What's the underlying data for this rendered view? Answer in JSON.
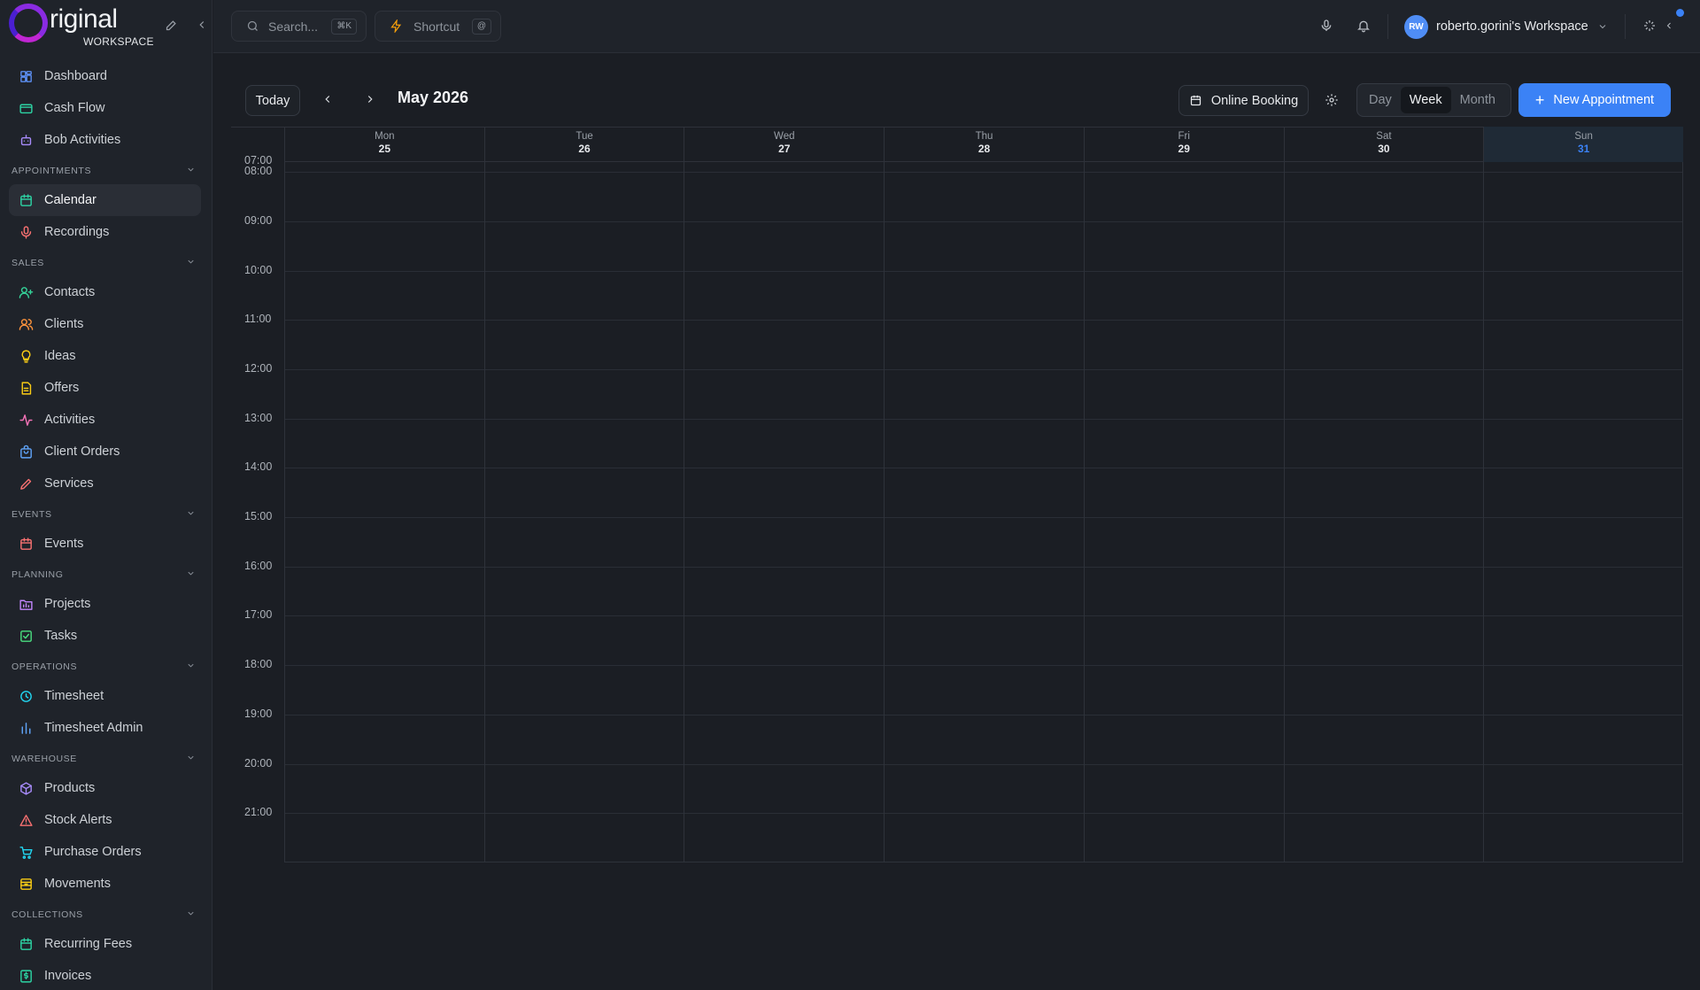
{
  "brand": {
    "logo_text": "riginal",
    "logo_sub": "WORKSPACE"
  },
  "sidebar": {
    "groups": [
      {
        "section": null,
        "items": [
          {
            "label": "Dashboard",
            "icon": "grid-icon",
            "color": "#5b8def"
          },
          {
            "label": "Cash Flow",
            "icon": "wallet-icon",
            "color": "#2dd4a4"
          },
          {
            "label": "Bob Activities",
            "icon": "bot-icon",
            "color": "#a78bfa"
          }
        ]
      },
      {
        "section": "APPOINTMENTS",
        "items": [
          {
            "label": "Calendar",
            "icon": "calendar-icon",
            "color": "#2dd4a4",
            "active": true
          },
          {
            "label": "Recordings",
            "icon": "mic-icon",
            "color": "#f87171"
          }
        ]
      },
      {
        "section": "SALES",
        "items": [
          {
            "label": "Contacts",
            "icon": "user-plus-icon",
            "color": "#34d399"
          },
          {
            "label": "Clients",
            "icon": "users-icon",
            "color": "#fb923c"
          },
          {
            "label": "Ideas",
            "icon": "lightbulb-icon",
            "color": "#facc15"
          },
          {
            "label": "Offers",
            "icon": "document-icon",
            "color": "#facc15"
          },
          {
            "label": "Activities",
            "icon": "activity-icon",
            "color": "#f472b6"
          },
          {
            "label": "Client Orders",
            "icon": "bag-icon",
            "color": "#60a5fa"
          },
          {
            "label": "Services",
            "icon": "pen-icon",
            "color": "#f87171"
          }
        ]
      },
      {
        "section": "EVENTS",
        "items": [
          {
            "label": "Events",
            "icon": "calendar-icon",
            "color": "#f87171"
          }
        ]
      },
      {
        "section": "PLANNING",
        "items": [
          {
            "label": "Projects",
            "icon": "folder-chart-icon",
            "color": "#c084fc"
          },
          {
            "label": "Tasks",
            "icon": "check-square-icon",
            "color": "#4ade80"
          }
        ]
      },
      {
        "section": "OPERATIONS",
        "items": [
          {
            "label": "Timesheet",
            "icon": "clock-icon",
            "color": "#22d3ee"
          },
          {
            "label": "Timesheet Admin",
            "icon": "bar-chart-icon",
            "color": "#60a5fa"
          }
        ]
      },
      {
        "section": "WAREHOUSE",
        "items": [
          {
            "label": "Products",
            "icon": "box-icon",
            "color": "#a78bfa"
          },
          {
            "label": "Stock Alerts",
            "icon": "alert-triangle-icon",
            "color": "#f87171"
          },
          {
            "label": "Purchase Orders",
            "icon": "cart-icon",
            "color": "#22d3ee"
          },
          {
            "label": "Movements",
            "icon": "archive-icon",
            "color": "#facc15"
          }
        ]
      },
      {
        "section": "COLLECTIONS",
        "items": [
          {
            "label": "Recurring Fees",
            "icon": "calendar-icon",
            "color": "#2dd4a4"
          },
          {
            "label": "Invoices",
            "icon": "dollar-file-icon",
            "color": "#2dd4a4"
          }
        ]
      }
    ]
  },
  "topbar": {
    "search_placeholder": "Search...",
    "search_kbd": "⌘K",
    "shortcut_label": "Shortcut",
    "shortcut_kbd": "@",
    "workspace_initials": "RW",
    "workspace_name": "roberto.gorini's Workspace"
  },
  "toolbar": {
    "today": "Today",
    "month_title": "May 2026",
    "online_booking": "Online Booking",
    "views": [
      "Day",
      "Week",
      "Month"
    ],
    "active_view": "Week",
    "new_appointment": "New Appointment"
  },
  "calendar": {
    "days": [
      {
        "name": "Mon",
        "date": "25"
      },
      {
        "name": "Tue",
        "date": "26"
      },
      {
        "name": "Wed",
        "date": "27"
      },
      {
        "name": "Thu",
        "date": "28"
      },
      {
        "name": "Fri",
        "date": "29"
      },
      {
        "name": "Sat",
        "date": "30"
      },
      {
        "name": "Sun",
        "date": "31",
        "today": true
      }
    ],
    "hours": [
      "07:00",
      "08:00",
      "09:00",
      "10:00",
      "11:00",
      "12:00",
      "13:00",
      "14:00",
      "15:00",
      "16:00",
      "17:00",
      "18:00",
      "19:00",
      "20:00",
      "21:00"
    ]
  },
  "colors": {
    "accent": "#3b82f6",
    "background": "#1b1e24",
    "sidebar": "#1f232a"
  }
}
